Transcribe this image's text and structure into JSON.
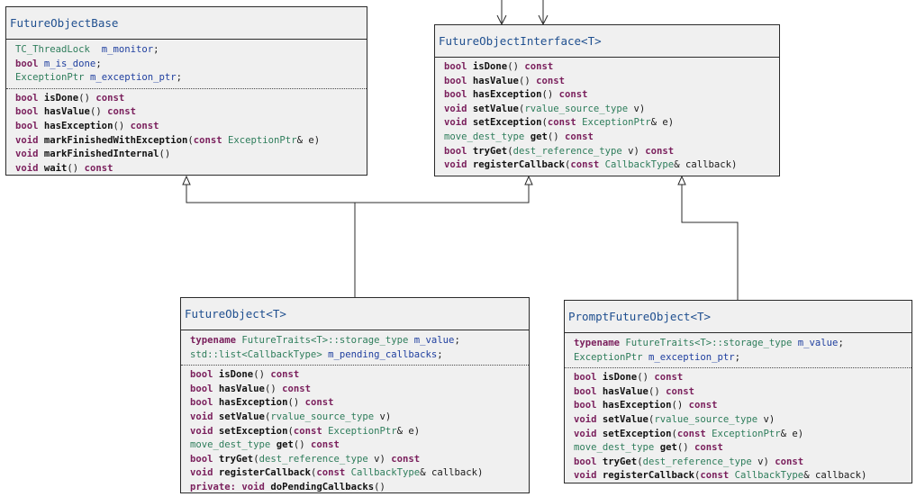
{
  "diagram": {
    "title": "",
    "classes": [
      {
        "id": "future-object-base",
        "name": "FutureObjectBase",
        "members": [
          [
            [
              "ty",
              "TC_ThreadLock"
            ],
            [
              "tx",
              "  "
            ],
            [
              "id",
              "m_monitor"
            ],
            [
              "tx",
              ";"
            ]
          ],
          [
            [
              "kw",
              "bool"
            ],
            [
              "tx",
              " "
            ],
            [
              "id",
              "m_is_done"
            ],
            [
              "tx",
              ";"
            ]
          ],
          [
            [
              "ty",
              "ExceptionPtr"
            ],
            [
              "tx",
              " "
            ],
            [
              "id",
              "m_exception_ptr"
            ],
            [
              "tx",
              ";"
            ]
          ]
        ],
        "methods": [
          [
            [
              "kw",
              "bool"
            ],
            [
              "tx",
              " "
            ],
            [
              "fn",
              "isDone"
            ],
            [
              "tx",
              "() "
            ],
            [
              "kw",
              "const"
            ]
          ],
          [
            [
              "kw",
              "bool"
            ],
            [
              "tx",
              " "
            ],
            [
              "fn",
              "hasValue"
            ],
            [
              "tx",
              "() "
            ],
            [
              "kw",
              "const"
            ]
          ],
          [
            [
              "kw",
              "bool"
            ],
            [
              "tx",
              " "
            ],
            [
              "fn",
              "hasException"
            ],
            [
              "tx",
              "() "
            ],
            [
              "kw",
              "const"
            ]
          ],
          [
            [
              "kw",
              "void"
            ],
            [
              "tx",
              " "
            ],
            [
              "fn",
              "markFinishedWithException"
            ],
            [
              "tx",
              "("
            ],
            [
              "kw",
              "const"
            ],
            [
              "tx",
              " "
            ],
            [
              "ty",
              "ExceptionPtr"
            ],
            [
              "tx",
              "& e)"
            ]
          ],
          [
            [
              "kw",
              "void"
            ],
            [
              "tx",
              " "
            ],
            [
              "fn",
              "markFinishedInternal"
            ],
            [
              "tx",
              "()"
            ]
          ],
          [
            [
              "kw",
              "void"
            ],
            [
              "tx",
              " "
            ],
            [
              "fn",
              "wait"
            ],
            [
              "tx",
              "() "
            ],
            [
              "kw",
              "const"
            ]
          ]
        ]
      },
      {
        "id": "future-object-interface",
        "name": "FutureObjectInterface<T>",
        "members": [],
        "methods": [
          [
            [
              "kw",
              "bool"
            ],
            [
              "tx",
              " "
            ],
            [
              "fn",
              "isDone"
            ],
            [
              "tx",
              "() "
            ],
            [
              "kw",
              "const"
            ]
          ],
          [
            [
              "kw",
              "bool"
            ],
            [
              "tx",
              " "
            ],
            [
              "fn",
              "hasValue"
            ],
            [
              "tx",
              "() "
            ],
            [
              "kw",
              "const"
            ]
          ],
          [
            [
              "kw",
              "bool"
            ],
            [
              "tx",
              " "
            ],
            [
              "fn",
              "hasException"
            ],
            [
              "tx",
              "() "
            ],
            [
              "kw",
              "const"
            ]
          ],
          [
            [
              "kw",
              "void"
            ],
            [
              "tx",
              " "
            ],
            [
              "fn",
              "setValue"
            ],
            [
              "tx",
              "("
            ],
            [
              "ty",
              "rvalue_source_type"
            ],
            [
              "tx",
              " v)"
            ]
          ],
          [
            [
              "kw",
              "void"
            ],
            [
              "tx",
              " "
            ],
            [
              "fn",
              "setException"
            ],
            [
              "tx",
              "("
            ],
            [
              "kw",
              "const"
            ],
            [
              "tx",
              " "
            ],
            [
              "ty",
              "ExceptionPtr"
            ],
            [
              "tx",
              "& e)"
            ]
          ],
          [
            [
              "ty",
              "move_dest_type"
            ],
            [
              "tx",
              " "
            ],
            [
              "fn",
              "get"
            ],
            [
              "tx",
              "() "
            ],
            [
              "kw",
              "const"
            ]
          ],
          [
            [
              "kw",
              "bool"
            ],
            [
              "tx",
              " "
            ],
            [
              "fn",
              "tryGet"
            ],
            [
              "tx",
              "("
            ],
            [
              "ty",
              "dest_reference_type"
            ],
            [
              "tx",
              " v) "
            ],
            [
              "kw",
              "const"
            ]
          ],
          [
            [
              "kw",
              "void"
            ],
            [
              "tx",
              " "
            ],
            [
              "fn",
              "registerCallback"
            ],
            [
              "tx",
              "("
            ],
            [
              "kw",
              "const"
            ],
            [
              "tx",
              " "
            ],
            [
              "ty",
              "CallbackType"
            ],
            [
              "tx",
              "& callback)"
            ]
          ]
        ]
      },
      {
        "id": "future-object",
        "name": "FutureObject<T>",
        "members": [
          [
            [
              "kw",
              "typename"
            ],
            [
              "tx",
              " "
            ],
            [
              "ty",
              "FutureTraits<T>::storage_type"
            ],
            [
              "tx",
              " "
            ],
            [
              "id",
              "m_value"
            ],
            [
              "tx",
              ";"
            ]
          ],
          [
            [
              "ty",
              "std::list<CallbackType>"
            ],
            [
              "tx",
              " "
            ],
            [
              "id",
              "m_pending_callbacks"
            ],
            [
              "tx",
              ";"
            ]
          ]
        ],
        "methods": [
          [
            [
              "kw",
              "bool"
            ],
            [
              "tx",
              " "
            ],
            [
              "fn",
              "isDone"
            ],
            [
              "tx",
              "() "
            ],
            [
              "kw",
              "const"
            ]
          ],
          [
            [
              "kw",
              "bool"
            ],
            [
              "tx",
              " "
            ],
            [
              "fn",
              "hasValue"
            ],
            [
              "tx",
              "() "
            ],
            [
              "kw",
              "const"
            ]
          ],
          [
            [
              "kw",
              "bool"
            ],
            [
              "tx",
              " "
            ],
            [
              "fn",
              "hasException"
            ],
            [
              "tx",
              "() "
            ],
            [
              "kw",
              "const"
            ]
          ],
          [
            [
              "kw",
              "void"
            ],
            [
              "tx",
              " "
            ],
            [
              "fn",
              "setValue"
            ],
            [
              "tx",
              "("
            ],
            [
              "ty",
              "rvalue_source_type"
            ],
            [
              "tx",
              " v)"
            ]
          ],
          [
            [
              "kw",
              "void"
            ],
            [
              "tx",
              " "
            ],
            [
              "fn",
              "setException"
            ],
            [
              "tx",
              "("
            ],
            [
              "kw",
              "const"
            ],
            [
              "tx",
              " "
            ],
            [
              "ty",
              "ExceptionPtr"
            ],
            [
              "tx",
              "& e)"
            ]
          ],
          [
            [
              "ty",
              "move_dest_type"
            ],
            [
              "tx",
              " "
            ],
            [
              "fn",
              "get"
            ],
            [
              "tx",
              "() "
            ],
            [
              "kw",
              "const"
            ]
          ],
          [
            [
              "kw",
              "bool"
            ],
            [
              "tx",
              " "
            ],
            [
              "fn",
              "tryGet"
            ],
            [
              "tx",
              "("
            ],
            [
              "ty",
              "dest_reference_type"
            ],
            [
              "tx",
              " v) "
            ],
            [
              "kw",
              "const"
            ]
          ],
          [
            [
              "kw",
              "void"
            ],
            [
              "tx",
              " "
            ],
            [
              "fn",
              "registerCallback"
            ],
            [
              "tx",
              "("
            ],
            [
              "kw",
              "const"
            ],
            [
              "tx",
              " "
            ],
            [
              "ty",
              "CallbackType"
            ],
            [
              "tx",
              "& callback)"
            ]
          ],
          [
            [
              "kw",
              "private:"
            ],
            [
              "tx",
              " "
            ],
            [
              "kw",
              "void"
            ],
            [
              "tx",
              " "
            ],
            [
              "fn",
              "doPendingCallbacks"
            ],
            [
              "tx",
              "()"
            ]
          ]
        ]
      },
      {
        "id": "prompt-future-object",
        "name": "PromptFutureObject<T>",
        "members": [
          [
            [
              "kw",
              "typename"
            ],
            [
              "tx",
              " "
            ],
            [
              "ty",
              "FutureTraits<T>::storage_type"
            ],
            [
              "tx",
              " "
            ],
            [
              "id",
              "m_value"
            ],
            [
              "tx",
              ";"
            ]
          ],
          [
            [
              "ty",
              "ExceptionPtr"
            ],
            [
              "tx",
              " "
            ],
            [
              "id",
              "m_exception_ptr"
            ],
            [
              "tx",
              ";"
            ]
          ]
        ],
        "methods": [
          [
            [
              "kw",
              "bool"
            ],
            [
              "tx",
              " "
            ],
            [
              "fn",
              "isDone"
            ],
            [
              "tx",
              "() "
            ],
            [
              "kw",
              "const"
            ]
          ],
          [
            [
              "kw",
              "bool"
            ],
            [
              "tx",
              " "
            ],
            [
              "fn",
              "hasValue"
            ],
            [
              "tx",
              "() "
            ],
            [
              "kw",
              "const"
            ]
          ],
          [
            [
              "kw",
              "bool"
            ],
            [
              "tx",
              " "
            ],
            [
              "fn",
              "hasException"
            ],
            [
              "tx",
              "() "
            ],
            [
              "kw",
              "const"
            ]
          ],
          [
            [
              "kw",
              "void"
            ],
            [
              "tx",
              " "
            ],
            [
              "fn",
              "setValue"
            ],
            [
              "tx",
              "("
            ],
            [
              "ty",
              "rvalue_source_type"
            ],
            [
              "tx",
              " v)"
            ]
          ],
          [
            [
              "kw",
              "void"
            ],
            [
              "tx",
              " "
            ],
            [
              "fn",
              "setException"
            ],
            [
              "tx",
              "("
            ],
            [
              "kw",
              "const"
            ],
            [
              "tx",
              " "
            ],
            [
              "ty",
              "ExceptionPtr"
            ],
            [
              "tx",
              "& e)"
            ]
          ],
          [
            [
              "ty",
              "move_dest_type"
            ],
            [
              "tx",
              " "
            ],
            [
              "fn",
              "get"
            ],
            [
              "tx",
              "() "
            ],
            [
              "kw",
              "const"
            ]
          ],
          [
            [
              "kw",
              "bool"
            ],
            [
              "tx",
              " "
            ],
            [
              "fn",
              "tryGet"
            ],
            [
              "tx",
              "("
            ],
            [
              "ty",
              "dest_reference_type"
            ],
            [
              "tx",
              " v) "
            ],
            [
              "kw",
              "const"
            ]
          ],
          [
            [
              "kw",
              "void"
            ],
            [
              "tx",
              " "
            ],
            [
              "fn",
              "registerCallback"
            ],
            [
              "tx",
              "("
            ],
            [
              "kw",
              "const"
            ],
            [
              "tx",
              " "
            ],
            [
              "ty",
              "CallbackType"
            ],
            [
              "tx",
              "& callback)"
            ]
          ]
        ]
      }
    ],
    "relationships": [
      {
        "type": "inheritance",
        "from": "future-object",
        "to": "future-object-base"
      },
      {
        "type": "inheritance",
        "from": "future-object",
        "to": "future-object-interface"
      },
      {
        "type": "inheritance",
        "from": "prompt-future-object",
        "to": "future-object-interface"
      },
      {
        "type": "dependency",
        "from": "offscreen",
        "to": "future-object-interface"
      }
    ],
    "colors": {
      "box_fill": "#f0f0f0",
      "border": "#2b2b2b",
      "title": "#1f4f8f",
      "keyword": "#7a1f5c",
      "type": "#2e7d5b",
      "identifier": "#1f3f9f"
    }
  }
}
